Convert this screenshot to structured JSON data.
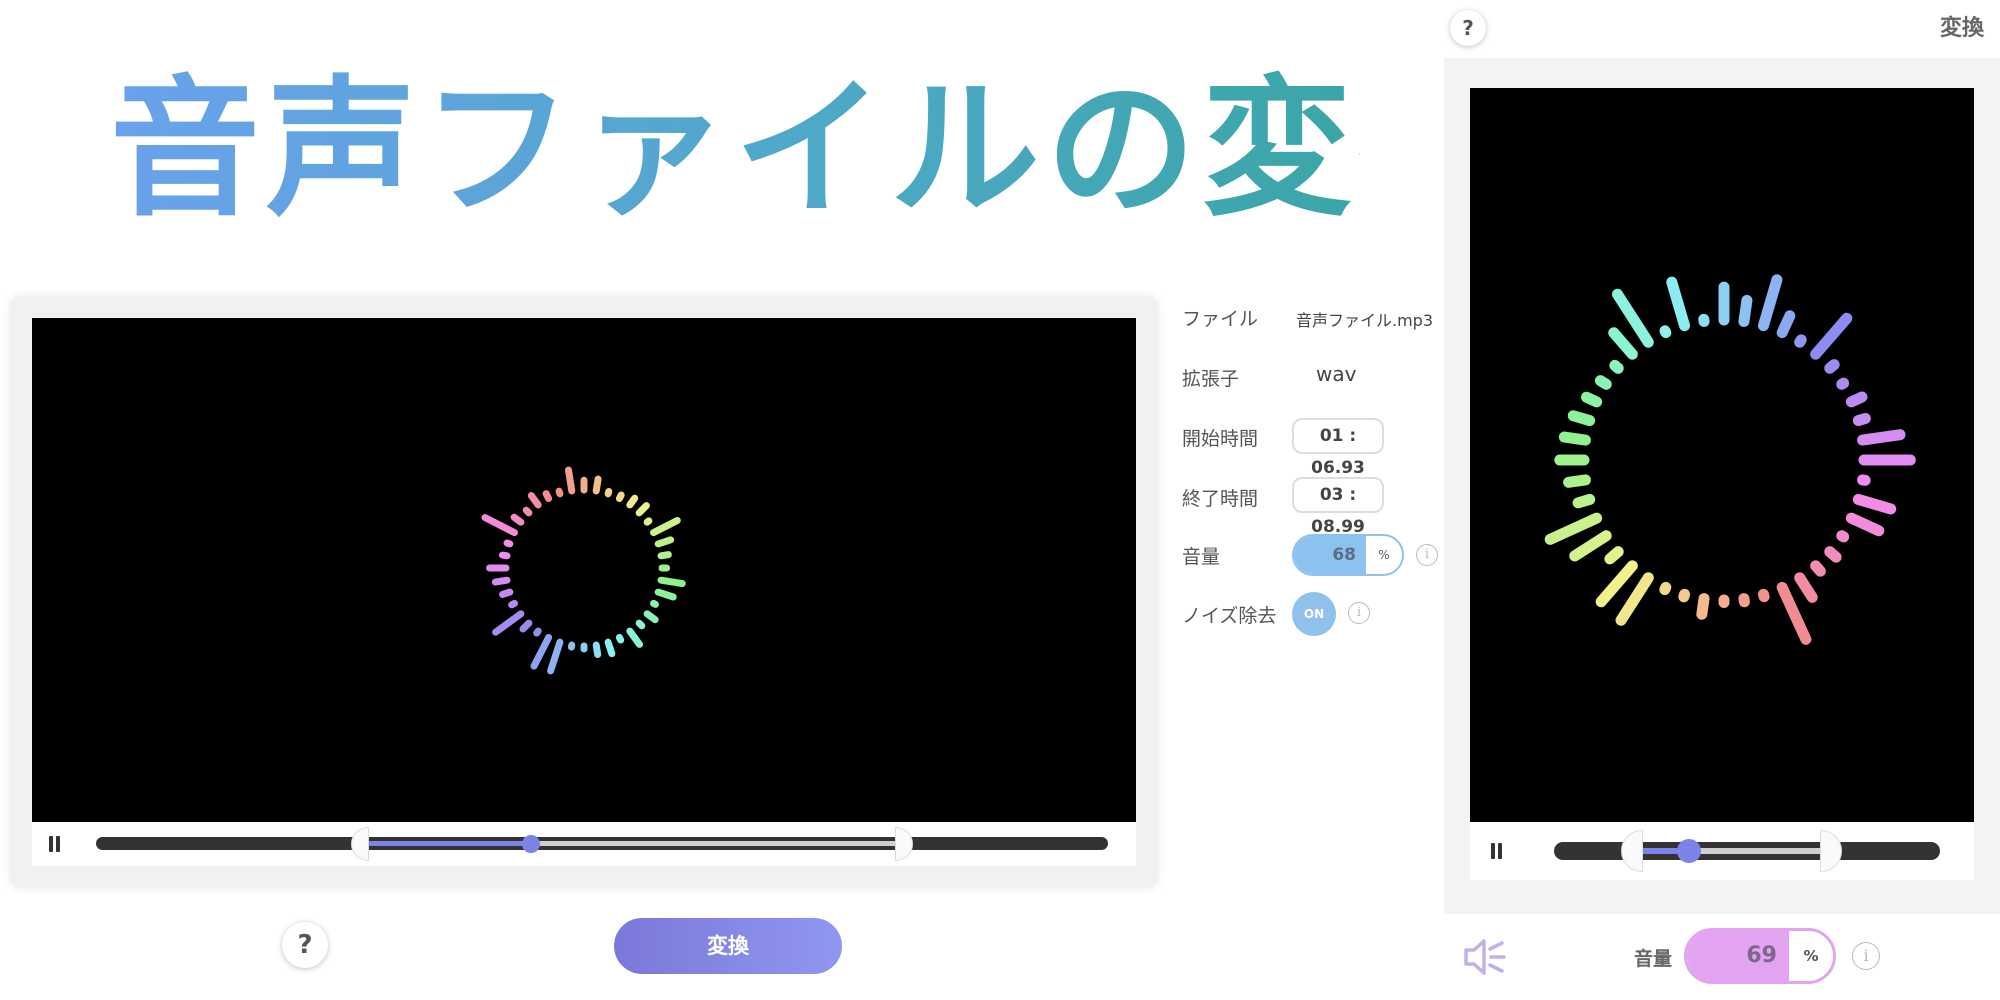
{
  "title": "音声ファイルの変換",
  "form": {
    "file_label": "ファイル",
    "file_value": "音声ファイル.mp3",
    "ext_label": "拡張子",
    "ext_value": "wav",
    "start_label": "開始時間",
    "start_value": "01 : 06.93",
    "end_label": "終了時間",
    "end_value": "03 : 08.99",
    "volume_label": "音量",
    "volume_value": "68",
    "volume_unit": "%",
    "noise_label": "ノイズ除去",
    "noise_toggle": "ON",
    "info_glyph": "i"
  },
  "player": {
    "progress": 0.43,
    "trim_start": 0.27,
    "trim_end": 0.79
  },
  "help_glyph": "?",
  "convert_button": "変換",
  "side_panel": {
    "title": "変換",
    "help_glyph": "?",
    "volume_label": "音量",
    "volume_value": "69",
    "volume_unit": "%",
    "player": {
      "progress": 0.35,
      "trim_start": 0.23,
      "trim_end": 0.69
    }
  },
  "colors": {
    "accent": "#7b83e6",
    "volume_main": "#8ec2ee",
    "volume_side": "#e2a3f0"
  },
  "icons": {
    "pause": "pause-icon",
    "help": "help-icon",
    "info": "info-icon",
    "speaker": "speaker-icon"
  }
}
